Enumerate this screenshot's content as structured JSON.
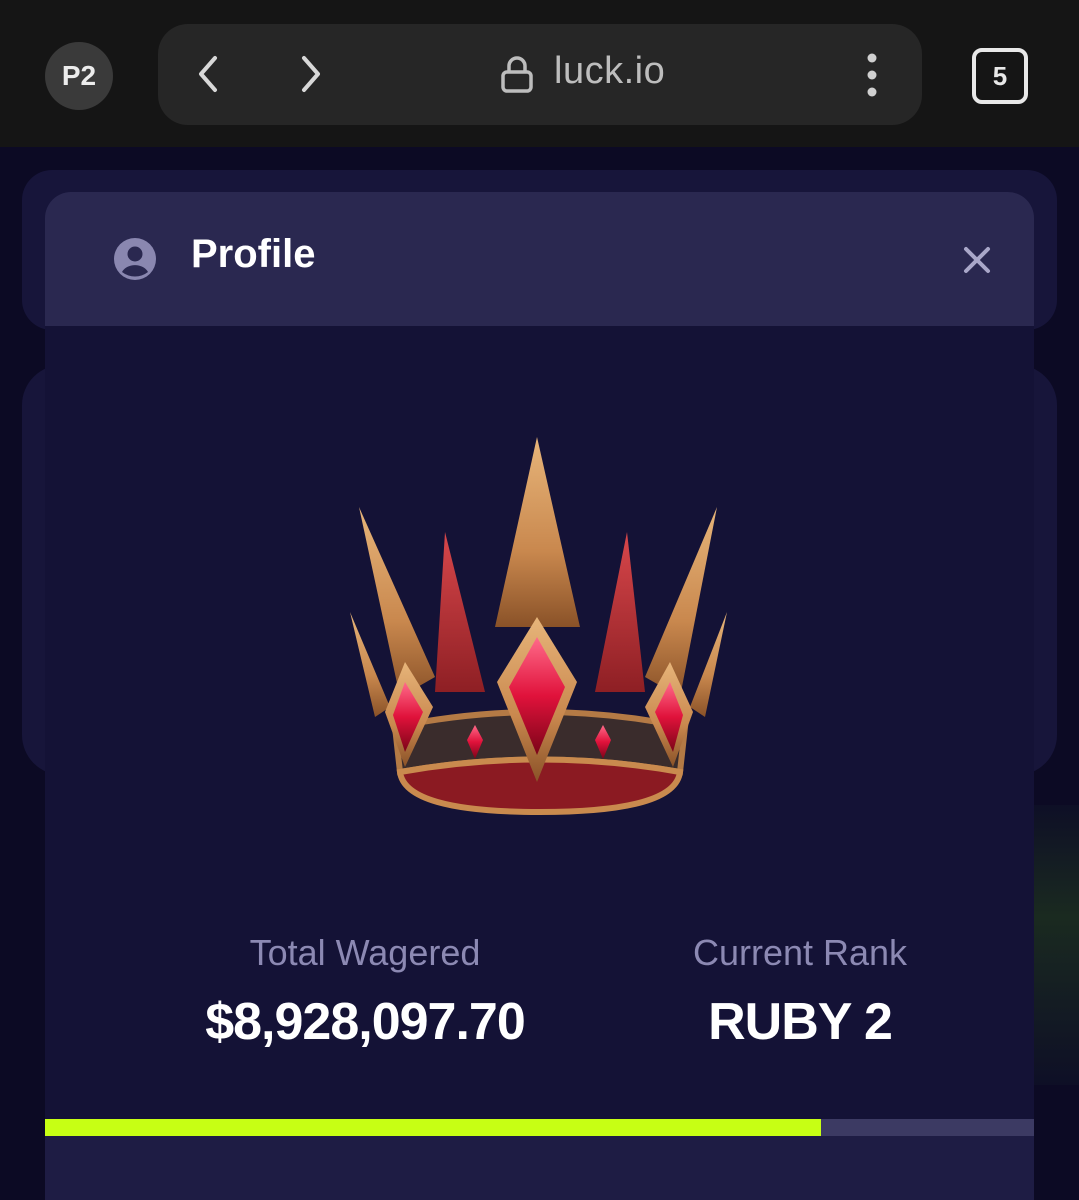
{
  "browser": {
    "profile": "P2",
    "url": "luck.io",
    "tab_count": "5"
  },
  "modal": {
    "title": "Profile",
    "stats": {
      "wagered_label": "Total Wagered",
      "wagered_value": "$8,928,097.70",
      "rank_label": "Current Rank",
      "rank_value": "RUBY 2"
    },
    "rank_progress": 0.785
  },
  "colors": {
    "progress_fill": "#c7ff14",
    "header_bg": "#2a2850",
    "modal_bg": "#141236"
  },
  "icons": [
    "back-arrow-icon",
    "forward-arrow-icon",
    "lock-icon",
    "more-vertical-icon",
    "user-circle-icon",
    "close-icon",
    "crown-icon"
  ]
}
